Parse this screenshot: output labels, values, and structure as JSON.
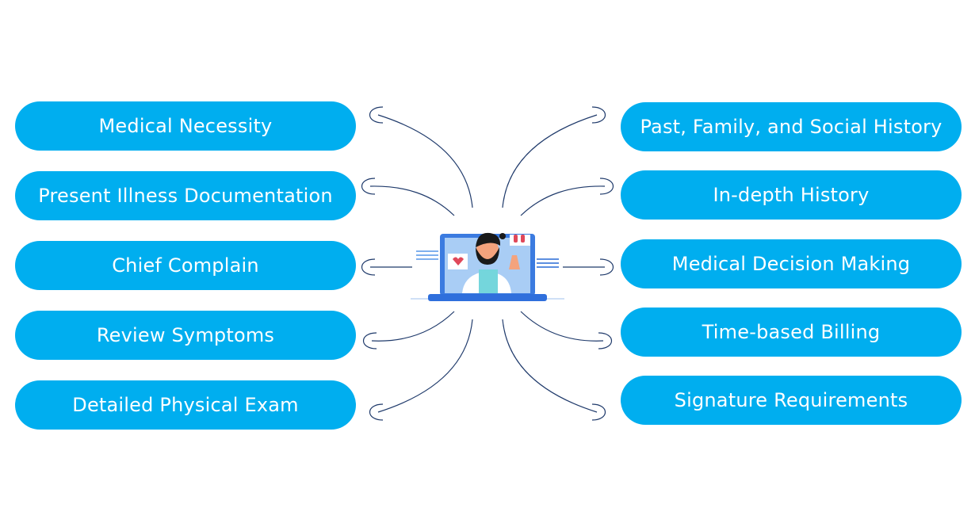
{
  "left_items": [
    "Medical Necessity",
    "Present Illness Documentation",
    "Chief Complain",
    "Review Symptoms",
    "Detailed Physical Exam"
  ],
  "right_items": [
    "Past, Family, and Social History",
    "In-depth History",
    "Medical Decision Making",
    "Time-based Billing",
    "Signature Requirements"
  ],
  "colors": {
    "pill": "#00aeef",
    "connector": "#1f3a6b",
    "laptop": "#3b7be0",
    "screen": "#a9cdf5"
  },
  "center_icon": "doctor-telehealth-laptop-icon"
}
